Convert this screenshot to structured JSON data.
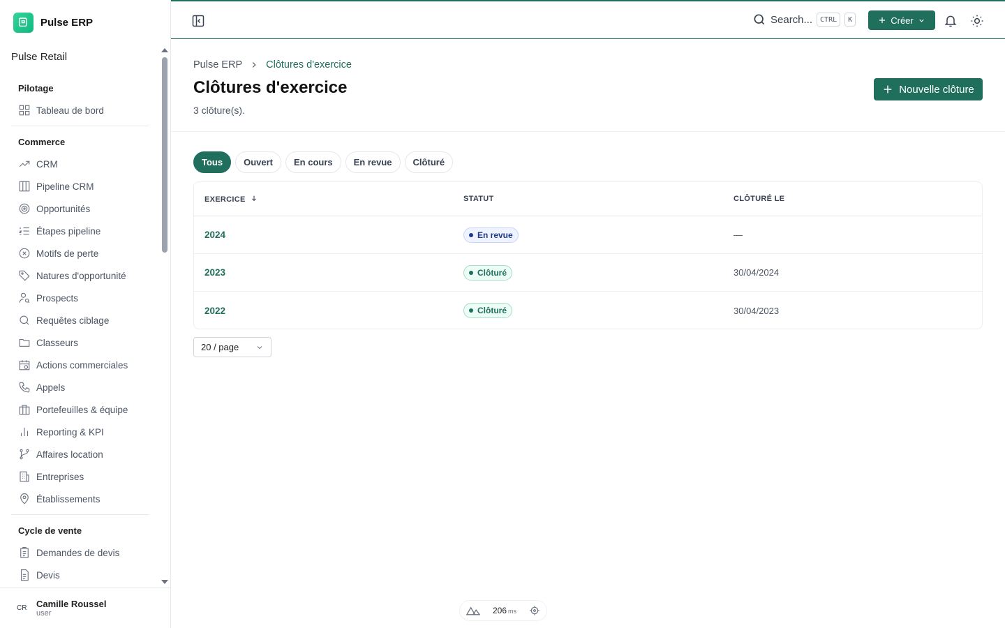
{
  "brand": {
    "name": "Pulse ERP"
  },
  "org": "Pulse Retail",
  "nav": {
    "groups": [
      {
        "title": "Pilotage",
        "items": [
          "Tableau de bord"
        ]
      },
      {
        "title": "Commerce",
        "items": [
          "CRM",
          "Pipeline CRM",
          "Opportunités",
          "Étapes pipeline",
          "Motifs de perte",
          "Natures d'opportunité",
          "Prospects",
          "Requêtes ciblage",
          "Classeurs",
          "Actions commerciales",
          "Appels",
          "Portefeuilles & équipe",
          "Reporting & KPI",
          "Affaires location",
          "Entreprises",
          "Établissements"
        ]
      },
      {
        "title": "Cycle de vente",
        "items": [
          "Demandes de devis",
          "Devis"
        ]
      }
    ]
  },
  "user": {
    "initials": "CR",
    "name": "Camille Roussel",
    "role": "user"
  },
  "topbar": {
    "search": "Search...",
    "kbd1": "CTRL",
    "kbd2": "K",
    "create": "Créer"
  },
  "breadcrumb": {
    "root": "Pulse ERP",
    "current": "Clôtures d'exercice"
  },
  "page": {
    "title": "Clôtures d'exercice",
    "subtitle": "3 clôture(s).",
    "new_button": "Nouvelle clôture"
  },
  "filters": [
    "Tous",
    "Ouvert",
    "En cours",
    "En revue",
    "Clôturé"
  ],
  "table": {
    "headers": {
      "exercice": "EXERCICE",
      "statut": "STATUT",
      "cloture": "CLÔTURÉ LE"
    },
    "rows": [
      {
        "exercice": "2024",
        "statut": "En revue",
        "cloture": "—"
      },
      {
        "exercice": "2023",
        "statut": "Clôturé",
        "cloture": "30/04/2024"
      },
      {
        "exercice": "2022",
        "statut": "Clôturé",
        "cloture": "30/04/2023"
      }
    ]
  },
  "pager": "20 / page",
  "perf": {
    "value": "206",
    "unit": "ms"
  },
  "colors": {
    "accent": "#1f6f5c"
  }
}
